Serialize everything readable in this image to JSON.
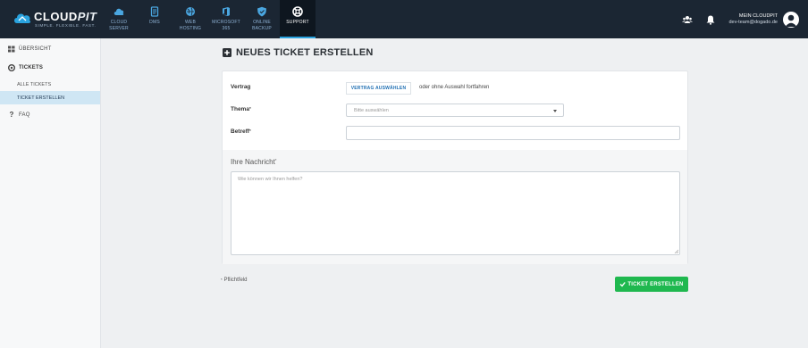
{
  "brand": {
    "name_part1": "CLOUD",
    "name_part2": "PIT",
    "tagline": "SIMPLE. FLEXIBLE. FAST."
  },
  "nav": {
    "items": [
      {
        "label": "CLOUD\nSERVER",
        "icon": "cloud-icon"
      },
      {
        "label": "DMS",
        "icon": "document-icon"
      },
      {
        "label": "WEB\nHOSTING",
        "icon": "globe-icon"
      },
      {
        "label": "MICROSOFT\n365",
        "icon": "office-icon"
      },
      {
        "label": "ONLINE\nBACKUP",
        "icon": "shield-icon"
      },
      {
        "label": "SUPPORT",
        "icon": "lifebuoy-icon",
        "active": true
      }
    ]
  },
  "account": {
    "title": "MEIN CLOUDPIT",
    "email": "dev-team@dogado.de"
  },
  "sidebar": {
    "overview": "ÜBERSICHT",
    "tickets": "TICKETS",
    "all_tickets": "ALLE TICKETS",
    "create_ticket": "TICKET ERSTELLEN",
    "faq": "FAQ"
  },
  "page": {
    "title": "NEUES TICKET ERSTELLEN"
  },
  "form": {
    "vertrag_label": "Vertrag",
    "vertrag_button": "VERTRAG AUSWÄHLEN",
    "vertrag_alt": "oder ohne Auswahl fortfahren",
    "thema_label": "Thema",
    "thema_placeholder": "Bitte auswählen",
    "betreff_label": "Betreff",
    "betreff_value": "",
    "message_label": "Ihre Nachricht",
    "message_placeholder": "Wie können wir Ihnen helfen?",
    "required_mark": "*",
    "footnote": "Pflichtfeld",
    "submit": "TICKET ERSTELLEN"
  },
  "colors": {
    "topbar": "#1b2633",
    "accent": "#2aa3df",
    "submit": "#1fb84f",
    "sidebar_active": "#cfe6f4"
  }
}
